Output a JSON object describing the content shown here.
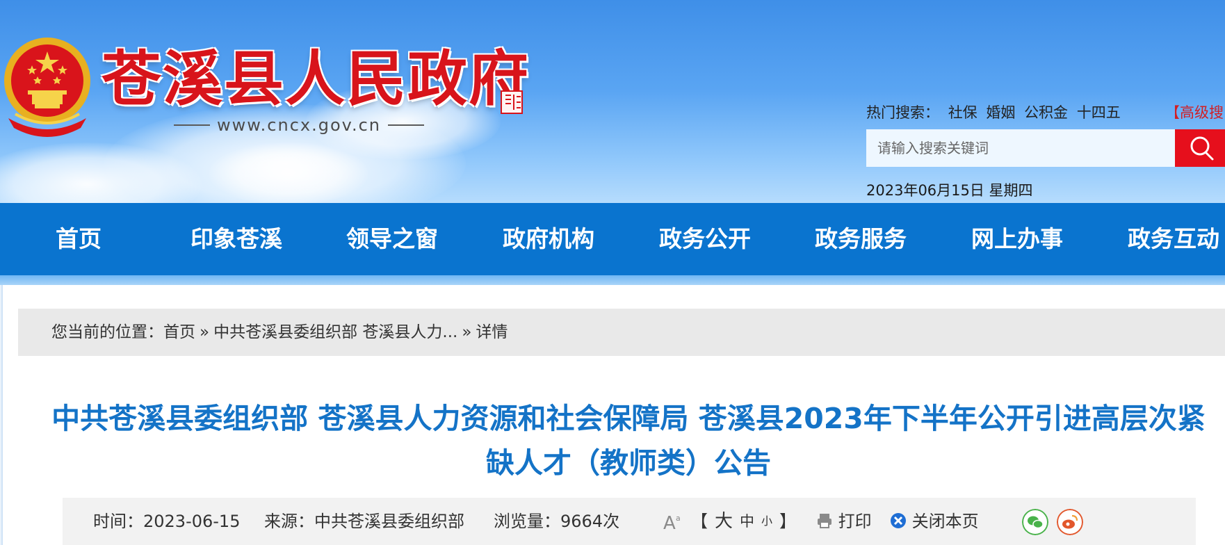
{
  "header": {
    "site_title": "苍溪县人民政府",
    "site_url": "www.cncx.gov.cn",
    "hot_search_label": "热门搜索：",
    "hot_search_terms": [
      "社保",
      "婚姻",
      "公积金",
      "十四五"
    ],
    "advanced_search": "【高级搜",
    "search_placeholder": "请输入搜索关键词",
    "date": "2023年06月15日 星期四"
  },
  "nav": {
    "items": [
      "首页",
      "印象苍溪",
      "领导之窗",
      "政府机构",
      "政务公开",
      "政务服务",
      "网上办事",
      "政务互动"
    ]
  },
  "breadcrumb": {
    "label": "您当前的位置：",
    "items": [
      "首页",
      "中共苍溪县委组织部 苍溪县人力...",
      "详情"
    ],
    "separator": "»"
  },
  "article": {
    "title": "中共苍溪县委组织部 苍溪县人力资源和社会保障局 苍溪县2023年下半年公开引进高层次紧缺人才（教师类）公告",
    "meta": {
      "time": "时间：2023-06-15",
      "source": "来源：中共苍溪县委组织部",
      "views": "浏览量：9664次",
      "font_open": "【",
      "font_large": "大",
      "font_medium": "中",
      "font_small": "小",
      "font_close": "】",
      "print": "打印",
      "close_page": "关闭本页"
    }
  },
  "colors": {
    "brand_red": "#d8141b",
    "nav_blue": "#0a74cf",
    "title_blue": "#1473c7",
    "search_red": "#e60f1c"
  },
  "icons": [
    "national-emblem-icon",
    "search-icon",
    "font-size-icon",
    "print-icon",
    "close-icon",
    "wechat-icon",
    "weibo-icon"
  ]
}
